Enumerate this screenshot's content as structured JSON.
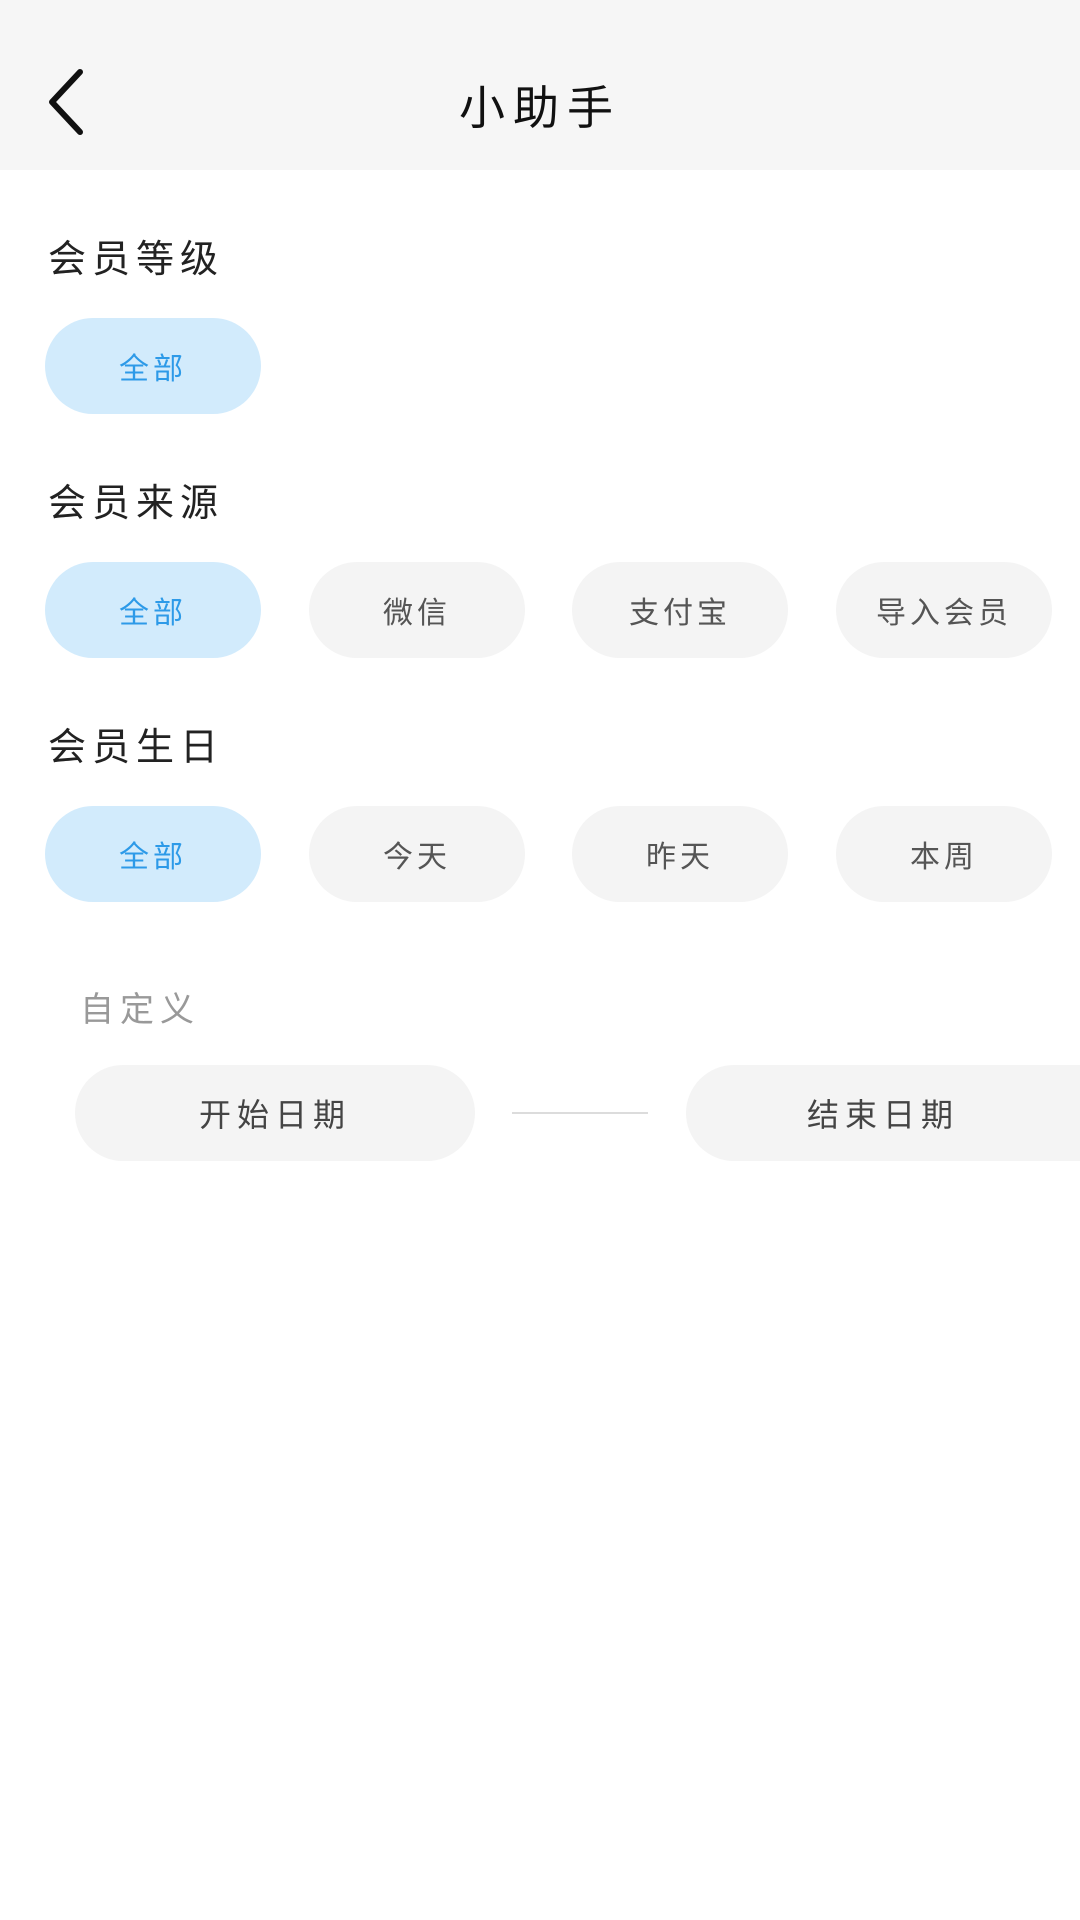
{
  "header": {
    "title": "小助手",
    "back_icon": "chevron-left-icon"
  },
  "member_level": {
    "label": "会员等级",
    "options": [
      "全部"
    ],
    "selected": "全部"
  },
  "member_source": {
    "label": "会员来源",
    "options": [
      "全部",
      "微信",
      "支付宝",
      "导入会员"
    ],
    "selected": "全部"
  },
  "member_birthday": {
    "label": "会员生日",
    "options": [
      "全部",
      "今天",
      "昨天",
      "本周"
    ],
    "selected": "全部"
  },
  "custom": {
    "label": "自定义",
    "start_placeholder": "开始日期",
    "end_placeholder": "结束日期"
  },
  "colors": {
    "active_bg": "#d2ebfc",
    "active_text": "#2d9ae8",
    "chip_bg": "#f4f4f4",
    "header_bg": "#f6f6f6"
  }
}
